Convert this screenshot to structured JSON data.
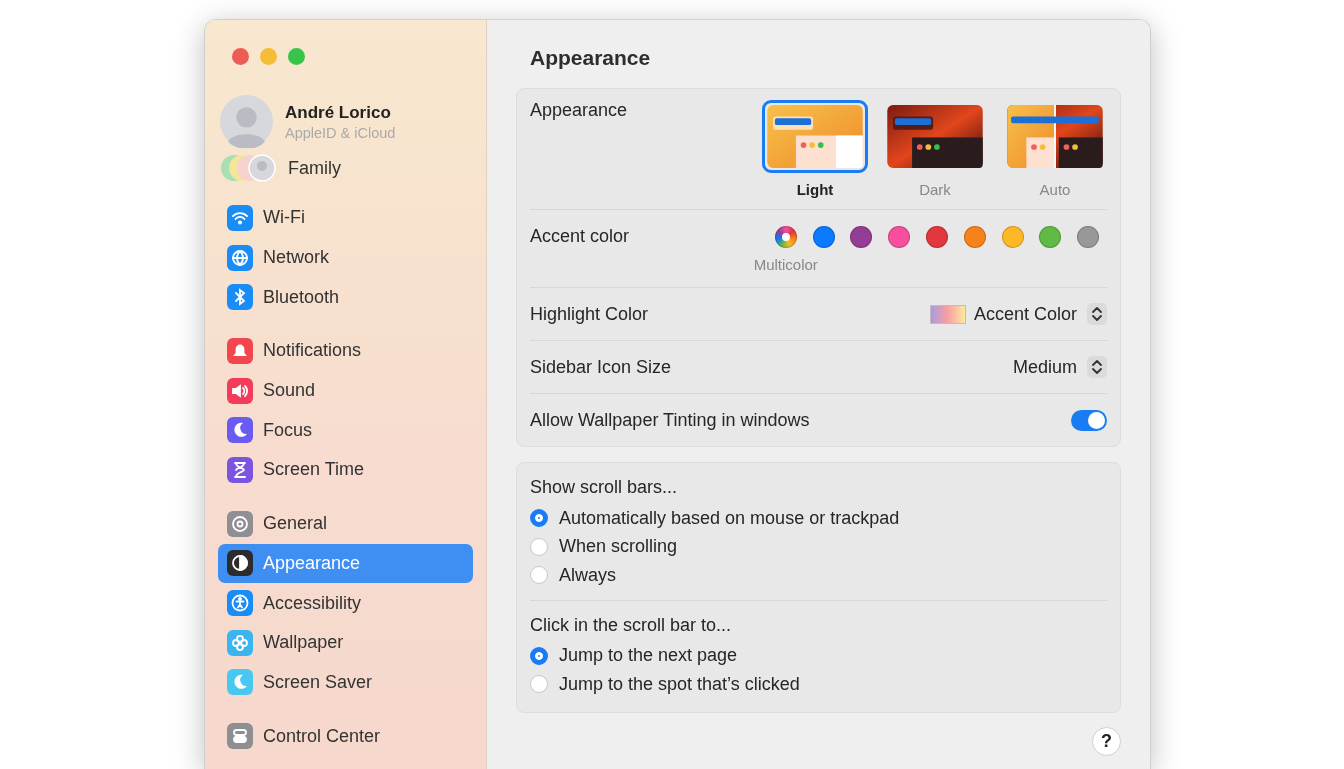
{
  "sidebar": {
    "account": {
      "name": "André Lorico",
      "subtitle": "AppleID & iCloud"
    },
    "family": {
      "label": "Family"
    },
    "groups": [
      {
        "items": [
          {
            "label": "Wi-Fi",
            "color": "#1a8cf5",
            "selected": false
          },
          {
            "label": "Network",
            "color": "#1a8cf5",
            "selected": false
          },
          {
            "label": "Bluetooth",
            "color": "#1a8cf5",
            "selected": false
          }
        ]
      },
      {
        "items": [
          {
            "label": "Notifications",
            "color": "#f2464e",
            "selected": false
          },
          {
            "label": "Sound",
            "color": "#f23c5a",
            "selected": false
          },
          {
            "label": "Focus",
            "color": "#6a5cf0",
            "selected": false
          },
          {
            "label": "Screen Time",
            "color": "#7b55e0",
            "selected": false
          }
        ]
      },
      {
        "items": [
          {
            "label": "General",
            "color": "#8e8e93",
            "selected": false
          },
          {
            "label": "Appearance",
            "color": "#2c2c2e",
            "selected": true
          },
          {
            "label": "Accessibility",
            "color": "#1a8cf5",
            "selected": false
          },
          {
            "label": "Wallpaper",
            "color": "#3bb5f0",
            "selected": false
          },
          {
            "label": "Screen Saver",
            "color": "#48c8f0",
            "selected": false
          }
        ]
      },
      {
        "items": [
          {
            "label": "Control Center",
            "color": "#8e8e93",
            "selected": false
          }
        ]
      }
    ]
  },
  "main": {
    "title": "Appearance",
    "appearance": {
      "label": "Appearance",
      "options": [
        {
          "kind": "light",
          "label": "Light",
          "selected": true
        },
        {
          "kind": "dark",
          "label": "Dark",
          "selected": false
        },
        {
          "kind": "auto",
          "label": "Auto",
          "selected": false
        }
      ]
    },
    "accent": {
      "label": "Accent color",
      "selected_name": "Multicolor",
      "colors": [
        {
          "kind": "multicolor",
          "selected": true
        },
        {
          "kind": "solid",
          "color": "#0a7aff",
          "selected": false
        },
        {
          "kind": "solid",
          "color": "#953d96",
          "selected": false
        },
        {
          "kind": "solid",
          "color": "#f74f9e",
          "selected": false
        },
        {
          "kind": "solid",
          "color": "#e0383e",
          "selected": false
        },
        {
          "kind": "solid",
          "color": "#f7821b",
          "selected": false
        },
        {
          "kind": "solid",
          "color": "#fcb827",
          "selected": false
        },
        {
          "kind": "solid",
          "color": "#62ba46",
          "selected": false
        },
        {
          "kind": "solid",
          "color": "#989898",
          "selected": false
        }
      ]
    },
    "highlight": {
      "label": "Highlight Color",
      "value": "Accent Color"
    },
    "icon_size": {
      "label": "Sidebar Icon Size",
      "value": "Medium"
    },
    "tinting": {
      "label": "Allow Wallpaper Tinting in windows",
      "on": true
    },
    "scroll_bars": {
      "label": "Show scroll bars...",
      "options": [
        {
          "label": "Automatically based on mouse or trackpad",
          "selected": true
        },
        {
          "label": "When scrolling",
          "selected": false
        },
        {
          "label": "Always",
          "selected": false
        }
      ]
    },
    "click_scroll": {
      "label": "Click in the scroll bar to...",
      "options": [
        {
          "label": "Jump to the next page",
          "selected": true
        },
        {
          "label": "Jump to the spot that’s clicked",
          "selected": false
        }
      ]
    },
    "help": {
      "label": "?"
    }
  }
}
